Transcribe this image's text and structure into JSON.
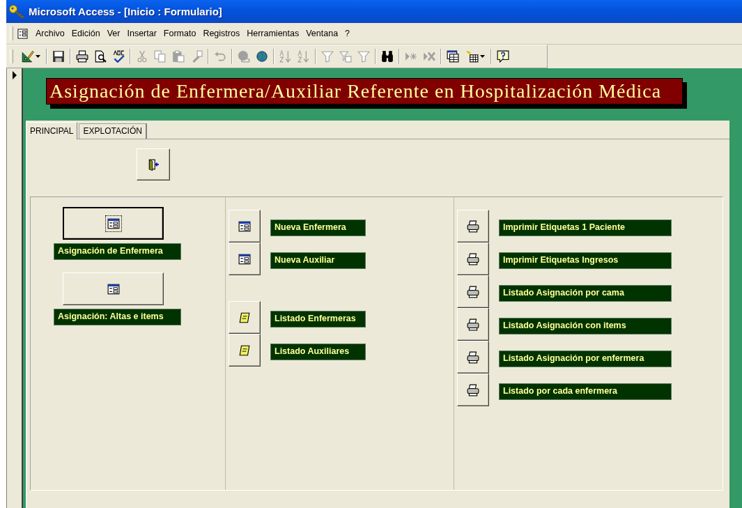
{
  "window": {
    "title": "Microsoft Access - [Inicio : Formulario]"
  },
  "menu": [
    "Archivo",
    "Edición",
    "Ver",
    "Insertar",
    "Formato",
    "Registros",
    "Herramientas",
    "Ventana",
    "?"
  ],
  "toolbar": [
    {
      "kind": "design-view",
      "disabled": false,
      "dropdown": true
    },
    {
      "kind": "separator"
    },
    {
      "kind": "save",
      "disabled": false
    },
    {
      "kind": "separator"
    },
    {
      "kind": "print",
      "disabled": false
    },
    {
      "kind": "print-preview",
      "disabled": false
    },
    {
      "kind": "spelling",
      "disabled": false
    },
    {
      "kind": "separator"
    },
    {
      "kind": "cut",
      "disabled": true
    },
    {
      "kind": "copy",
      "disabled": true
    },
    {
      "kind": "paste",
      "disabled": true
    },
    {
      "kind": "format-painter",
      "disabled": true
    },
    {
      "kind": "separator"
    },
    {
      "kind": "undo",
      "disabled": true
    },
    {
      "kind": "separator"
    },
    {
      "kind": "hyperlink",
      "disabled": true
    },
    {
      "kind": "web",
      "disabled": false
    },
    {
      "kind": "separator"
    },
    {
      "kind": "sort-ascending",
      "disabled": true
    },
    {
      "kind": "sort-descending",
      "disabled": true
    },
    {
      "kind": "separator"
    },
    {
      "kind": "filter-selection",
      "disabled": true
    },
    {
      "kind": "filter-form",
      "disabled": true
    },
    {
      "kind": "filter",
      "disabled": true
    },
    {
      "kind": "separator"
    },
    {
      "kind": "find",
      "disabled": false
    },
    {
      "kind": "separator"
    },
    {
      "kind": "new-record",
      "disabled": true
    },
    {
      "kind": "delete-record",
      "disabled": true
    },
    {
      "kind": "separator"
    },
    {
      "kind": "database-window",
      "disabled": false
    },
    {
      "kind": "new-object",
      "disabled": false,
      "dropdown": true
    },
    {
      "kind": "separator"
    },
    {
      "kind": "help",
      "disabled": false
    }
  ],
  "form": {
    "header": "Asignación de Enfermera/Auxiliar Referente en Hospitalización Médica",
    "tabs": [
      {
        "label": "PRINCIPAL",
        "selected": true
      },
      {
        "label": "EXPLOTACIÓN",
        "selected": false
      }
    ],
    "left": [
      {
        "kind": "form",
        "focused": true,
        "label": "Asignación de Enfermera"
      },
      {
        "kind": "form",
        "focused": false,
        "label": "Asignación: Altas e items"
      }
    ],
    "middle": [
      {
        "buttons": [
          {
            "kind": "form",
            "label": "Nueva Enfermera"
          },
          {
            "kind": "form",
            "label": "Nueva Auxiliar"
          }
        ]
      },
      {
        "buttons": [
          {
            "kind": "report",
            "label": "Listado Enfermeras"
          },
          {
            "kind": "report",
            "label": "Listado Auxiliares"
          }
        ]
      }
    ],
    "right": [
      {
        "kind": "printer",
        "label": "Imprimir Etiquetas 1 Paciente"
      },
      {
        "kind": "printer",
        "label": "Imprimir Etiquetas Ingresos"
      },
      {
        "kind": "printer",
        "label": "Listado Asignación por cama"
      },
      {
        "kind": "printer",
        "label": "Listado Asignación con items"
      },
      {
        "kind": "printer",
        "label": "Listado Asignación por enfermera"
      },
      {
        "kind": "printer",
        "label": "Listado por cada enfermera"
      }
    ]
  }
}
